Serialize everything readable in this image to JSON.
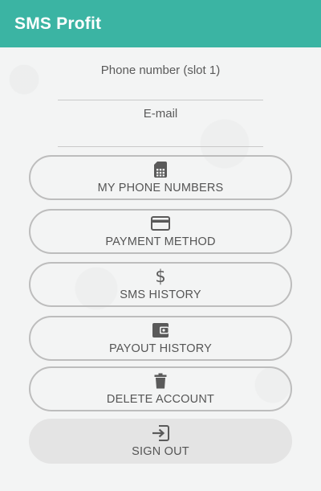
{
  "app_bar": {
    "title": "SMS Profit",
    "color": "#3bb4a3"
  },
  "fields": {
    "phone": {
      "label": "Phone number (slot 1)",
      "value": ""
    },
    "email": {
      "label": "E-mail",
      "value": ""
    }
  },
  "buttons": {
    "phone_numbers": {
      "label": "MY PHONE NUMBERS",
      "icon": "sim-card-icon"
    },
    "payment_method": {
      "label": "PAYMENT METHOD",
      "icon": "credit-card-icon"
    },
    "sms_history": {
      "label": "SMS HISTORY",
      "icon": "dollar-icon"
    },
    "payout_history": {
      "label": "PAYOUT HISTORY",
      "icon": "wallet-icon"
    },
    "delete_account": {
      "label": "DELETE ACCOUNT",
      "icon": "trash-icon"
    },
    "sign_out": {
      "label": "SIGN OUT",
      "icon": "exit-icon"
    }
  }
}
